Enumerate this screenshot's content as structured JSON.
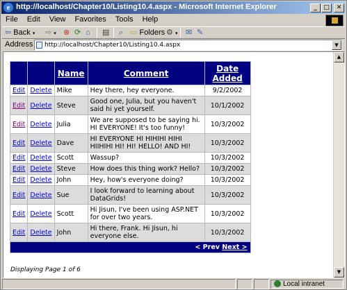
{
  "window": {
    "title": "http://localhost/Chapter10/Listing10.4.aspx - Microsoft Internet Explorer",
    "min_label": "_",
    "max_label": "□",
    "close_label": "✕"
  },
  "menu": {
    "items": [
      {
        "label": "File"
      },
      {
        "label": "Edit"
      },
      {
        "label": "View"
      },
      {
        "label": "Favorites"
      },
      {
        "label": "Tools"
      },
      {
        "label": "Help"
      }
    ]
  },
  "toolbar": {
    "back_label": "Back",
    "folders_label": "Folders"
  },
  "address": {
    "label": "Address",
    "url": "http://localhost/Chapter10/Listing10.4.aspx"
  },
  "grid": {
    "headers": [
      "",
      "",
      "Name",
      "Comment",
      "Date Added"
    ],
    "edit_label": "Edit",
    "delete_label": "Delete",
    "rows": [
      {
        "name": "Mike",
        "comment": "Hey there, hey everyone.",
        "date": "9/2/2002"
      },
      {
        "name": "Steve",
        "comment": "Good one, Julia, but you haven't said hi yet yourself.",
        "date": "10/1/2002"
      },
      {
        "name": "Julia",
        "comment": "We are supposed to be saying hi. HI EVERYONE! It's too funny!",
        "date": "10/3/2002"
      },
      {
        "name": "Dave",
        "comment": "HI EVERYONE HI HIHIHI HIHI HIIHIHI HI! HI! HELLO! AND HI!",
        "date": "10/3/2002"
      },
      {
        "name": "Scott",
        "comment": "Wassup?",
        "date": "10/3/2002"
      },
      {
        "name": "Steve",
        "comment": "How does this thing work? Hello?",
        "date": "10/3/2002"
      },
      {
        "name": "John",
        "comment": "Hey, how's everyone doing?",
        "date": "10/3/2002"
      },
      {
        "name": "Sue",
        "comment": "I look forward to learning about DataGrids!",
        "date": "10/3/2002"
      },
      {
        "name": "Scott",
        "comment": "Hi Jisun, I've been using ASP.NET for over two years.",
        "date": "10/3/2002"
      },
      {
        "name": "John",
        "comment": "Hi there, Frank. Hi Jisun, hi everyone else.",
        "date": "10/3/2002"
      }
    ],
    "pager_prev": "< Prev",
    "pager_next": "Next >"
  },
  "page_info": "Displaying Page 1 of 6",
  "status": {
    "zone": "Local intranet"
  }
}
